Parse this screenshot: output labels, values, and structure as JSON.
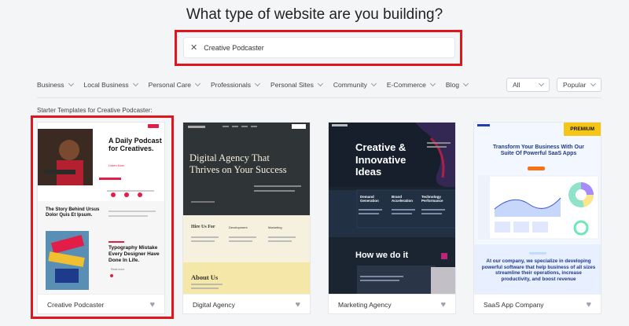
{
  "page_title": "What type of website are you building?",
  "search": {
    "value": "Creative Podcaster"
  },
  "filters": [
    {
      "label": "Business"
    },
    {
      "label": "Local Business"
    },
    {
      "label": "Personal Care"
    },
    {
      "label": "Professionals"
    },
    {
      "label": "Personal Sites"
    },
    {
      "label": "Community"
    },
    {
      "label": "E-Commerce"
    },
    {
      "label": "Blog"
    }
  ],
  "type_select": {
    "value": "All"
  },
  "sort_select": {
    "value": "Popular"
  },
  "section_label": "Starter Templates for Creative Podcaster:",
  "cards": [
    {
      "name": "Creative Podcaster",
      "hero_title": "A Daily Podcast for Creatives.",
      "story_title": "The Story Behind Ursus Dolor Quis Et Ipsum.",
      "blog_title": "Typography Mistake Every Designer Have Done In Life.",
      "listen_label": "Listen Now",
      "accent": "#e11d48"
    },
    {
      "name": "Digital Agency",
      "hero_title": "Digital Agency That Thrives on Your Success",
      "cols": [
        "Hire Us For",
        "Development",
        "Marketing"
      ],
      "about": "About Us",
      "accent": "#f2e9c8"
    },
    {
      "name": "Marketing Agency",
      "hero_title": "Creative & Innovative Ideas",
      "features": [
        "Demand Generation",
        "Brand Acceleration",
        "Technology Performance"
      ],
      "how": "How we do it",
      "accent": "#1b2532"
    },
    {
      "name": "SaaS App Company",
      "badge": "PREMIUM",
      "hero_title": "Transform Your Business With Our Suite Of Powerful SaaS Apps",
      "body": "At our company, we specialize in developing powerful software that help business of all sizes streamline their operations, increase productivity, and boost revenue",
      "accent": "#1e40af"
    }
  ]
}
